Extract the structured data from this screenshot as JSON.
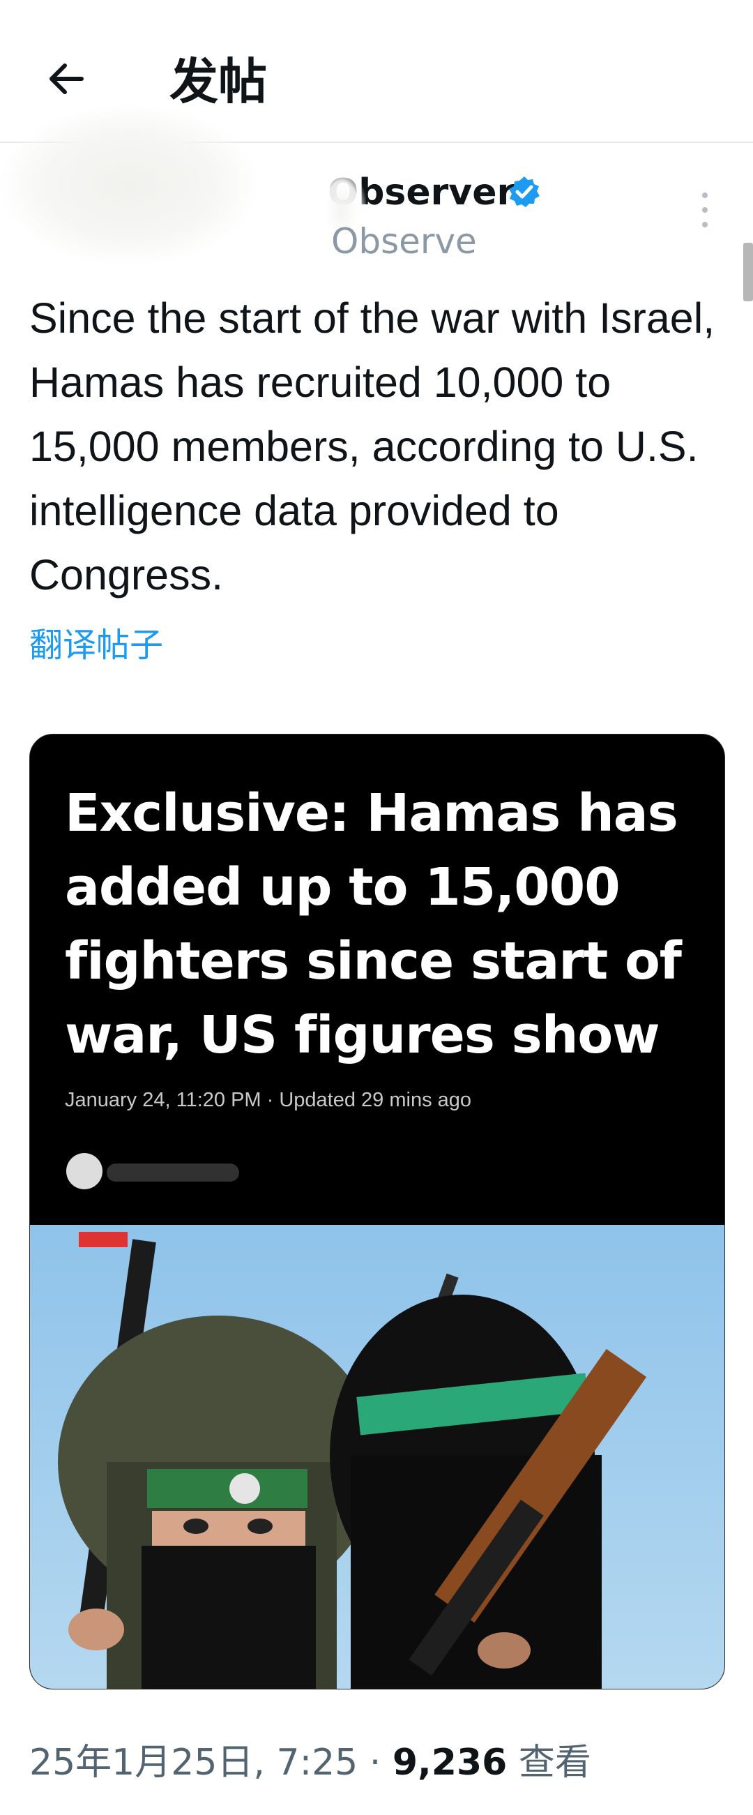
{
  "header": {
    "title": "发帖"
  },
  "post": {
    "author": {
      "display_name": "Observer",
      "handle": "Observe"
    },
    "text": "Since the start of the war with Israel, Hamas has recruited 10,000 to 15,000 members, according to U.S. intelligence data provided to Congress.",
    "translate_label": "翻译帖子",
    "media": {
      "headline": "Exclusive: Hamas has added up to 15,000 fighters since start of war, US figures show",
      "meta": "January 24, 11:20 PM · Updated 29 mins ago"
    },
    "timestamp": "25年1月25日, 7:25 · ",
    "views_count": "9,236",
    "views_label": " 查看"
  },
  "colors": {
    "link": "#1d9bf0",
    "verified": "#1d9bf0",
    "secondary_text": "#536471"
  }
}
